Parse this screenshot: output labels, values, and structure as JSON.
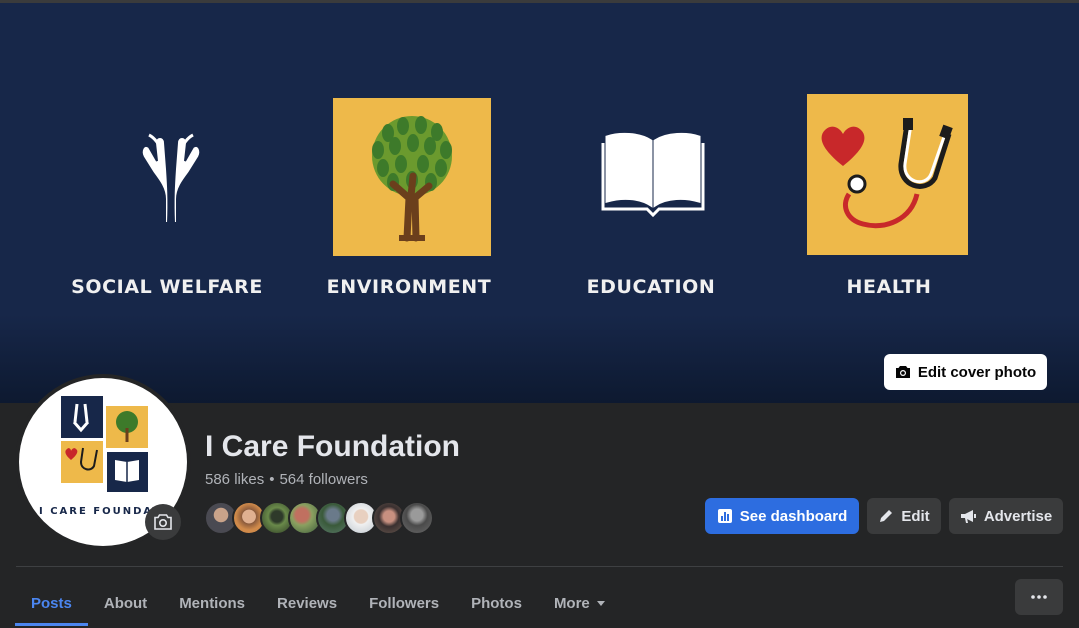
{
  "cover": {
    "categories": [
      {
        "label": "SOCIAL WELFARE",
        "icon": "praying-hands-icon"
      },
      {
        "label": "ENVIRONMENT",
        "icon": "tree-icon"
      },
      {
        "label": "EDUCATION",
        "icon": "open-book-icon"
      },
      {
        "label": "HEALTH",
        "icon": "stethoscope-heart-icon"
      }
    ],
    "edit_cover_label": "Edit cover photo"
  },
  "profile": {
    "name": "I Care Foundation",
    "logo_text": "I CARE FOUNDATION",
    "likes": "586 likes",
    "separator": "•",
    "followers": "564 followers"
  },
  "actions": {
    "dashboard_label": "See dashboard",
    "edit_label": "Edit",
    "advertise_label": "Advertise"
  },
  "tabs": [
    {
      "label": "Posts",
      "active": true
    },
    {
      "label": "About"
    },
    {
      "label": "Mentions"
    },
    {
      "label": "Reviews"
    },
    {
      "label": "Followers"
    },
    {
      "label": "Photos"
    },
    {
      "label": "More"
    }
  ],
  "colors": {
    "cover_bg": "#172749",
    "accent_yellow": "#eeb94a",
    "primary_blue": "#2d6de0",
    "active_tab": "#4b86f0"
  }
}
